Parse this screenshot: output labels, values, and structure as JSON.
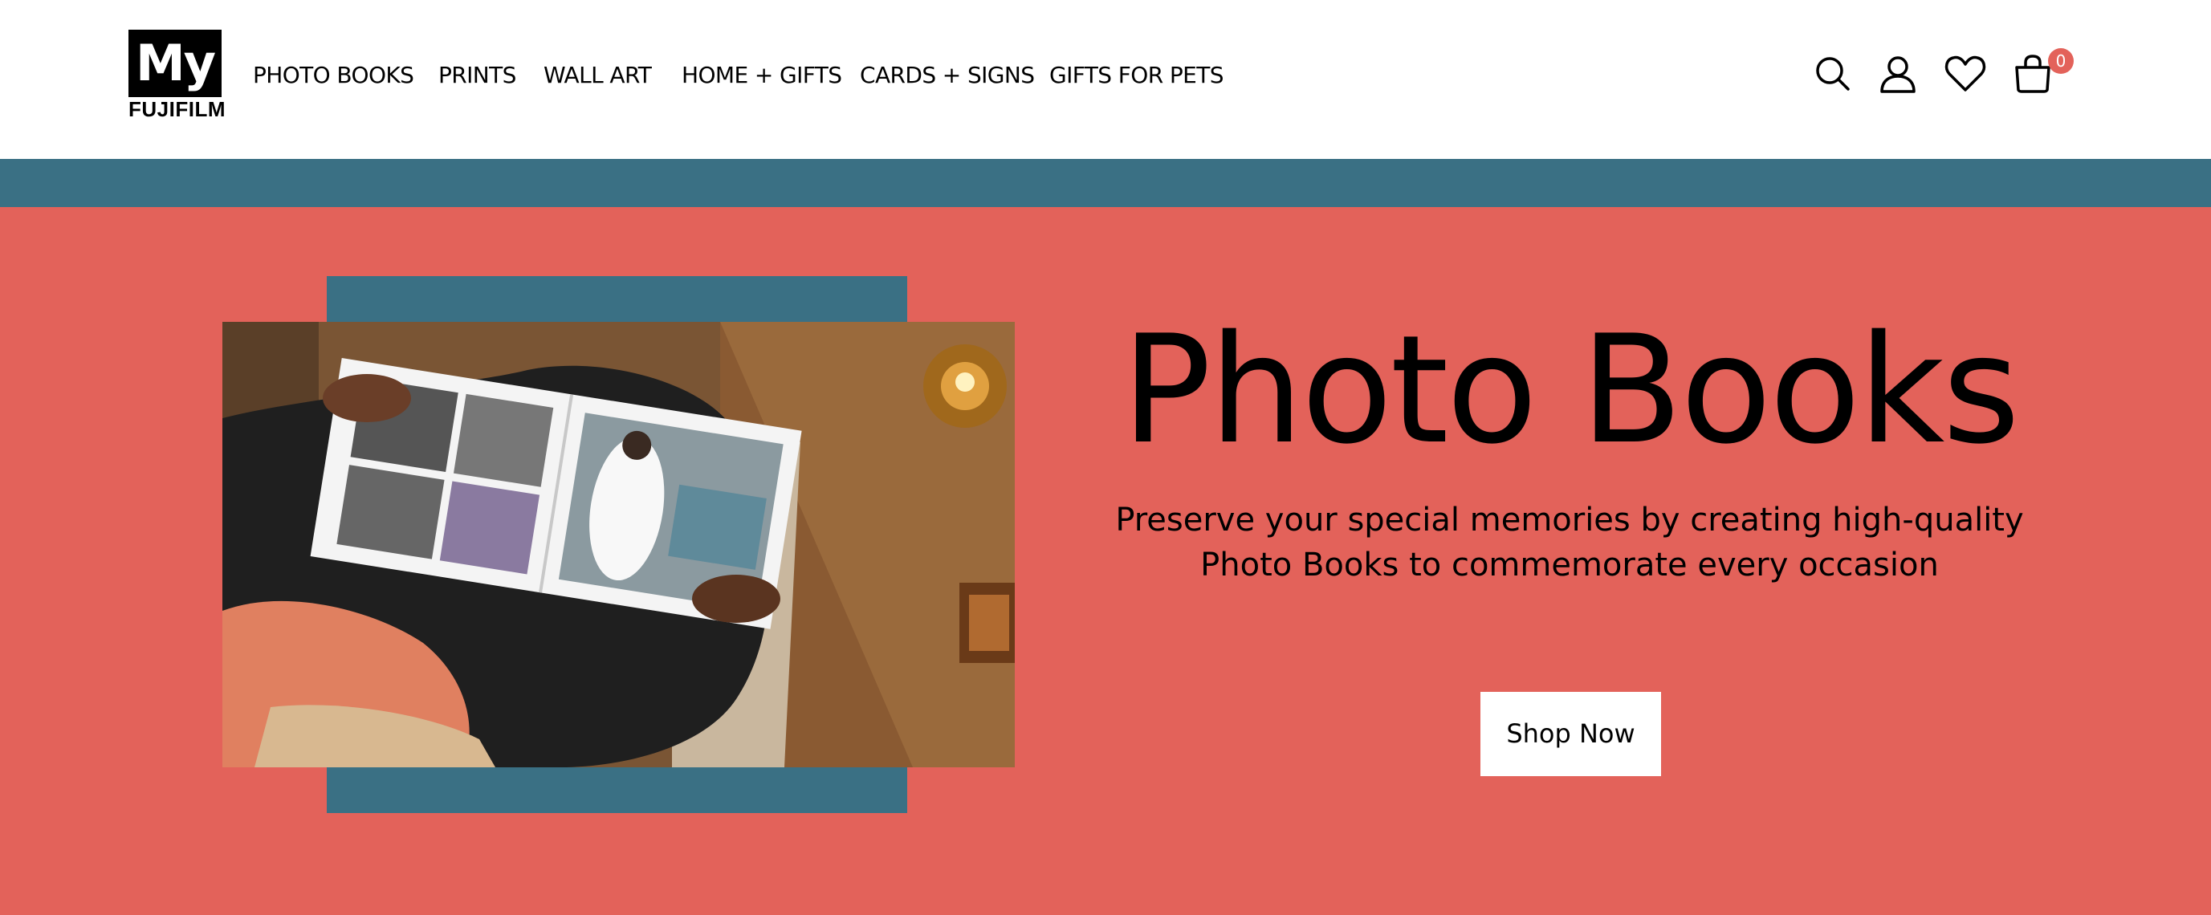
{
  "brand": {
    "logo_top": "My",
    "logo_bottom": "FUJIFILM"
  },
  "nav": {
    "items": [
      {
        "label": "PHOTO BOOKS"
      },
      {
        "label": "PRINTS"
      },
      {
        "label": "WALL ART"
      },
      {
        "label": "HOME + GIFTS"
      },
      {
        "label": "CARDS + SIGNS"
      },
      {
        "label": "GIFTS FOR PETS"
      }
    ]
  },
  "header_icons": {
    "search": "search-icon",
    "account": "user-icon",
    "wishlist": "heart-icon",
    "cart": "shopping-bag-icon",
    "cart_count": "0"
  },
  "hero": {
    "title": "Photo Books",
    "subtitle_line1": "Preserve your special memories by creating high-quality",
    "subtitle_line2": "Photo Books to commemorate every occasion",
    "cta_label": "Shop Now",
    "image_description_icon": "photo-book-image"
  },
  "colors": {
    "accent": "#e3625a",
    "teal": "#3a7084",
    "header_bg": "#ffffff"
  }
}
